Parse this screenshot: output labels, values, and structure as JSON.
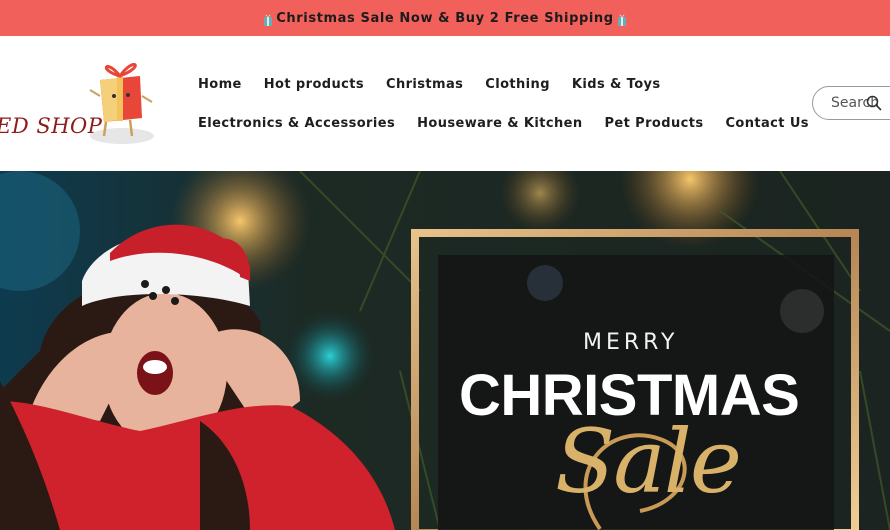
{
  "announcement": {
    "text": "Christmas Sale Now & Buy 2 Free Shipping",
    "icon": "gift-icon",
    "background": "#f2605c"
  },
  "logo": {
    "text": "ED SHOP",
    "icon": "gift-box-icon"
  },
  "nav": {
    "row1": [
      "Home",
      "Hot products",
      "Christmas",
      "Clothing",
      "Kids & Toys"
    ],
    "row2": [
      "Electronics & Accessories",
      "Houseware & Kitchen",
      "Pet Products",
      "Contact Us"
    ]
  },
  "search": {
    "placeholder": "Search",
    "icon": "search-icon"
  },
  "hero": {
    "merry": "MERRY",
    "christmas": "CHRISTMAS",
    "sale": "Sale"
  }
}
